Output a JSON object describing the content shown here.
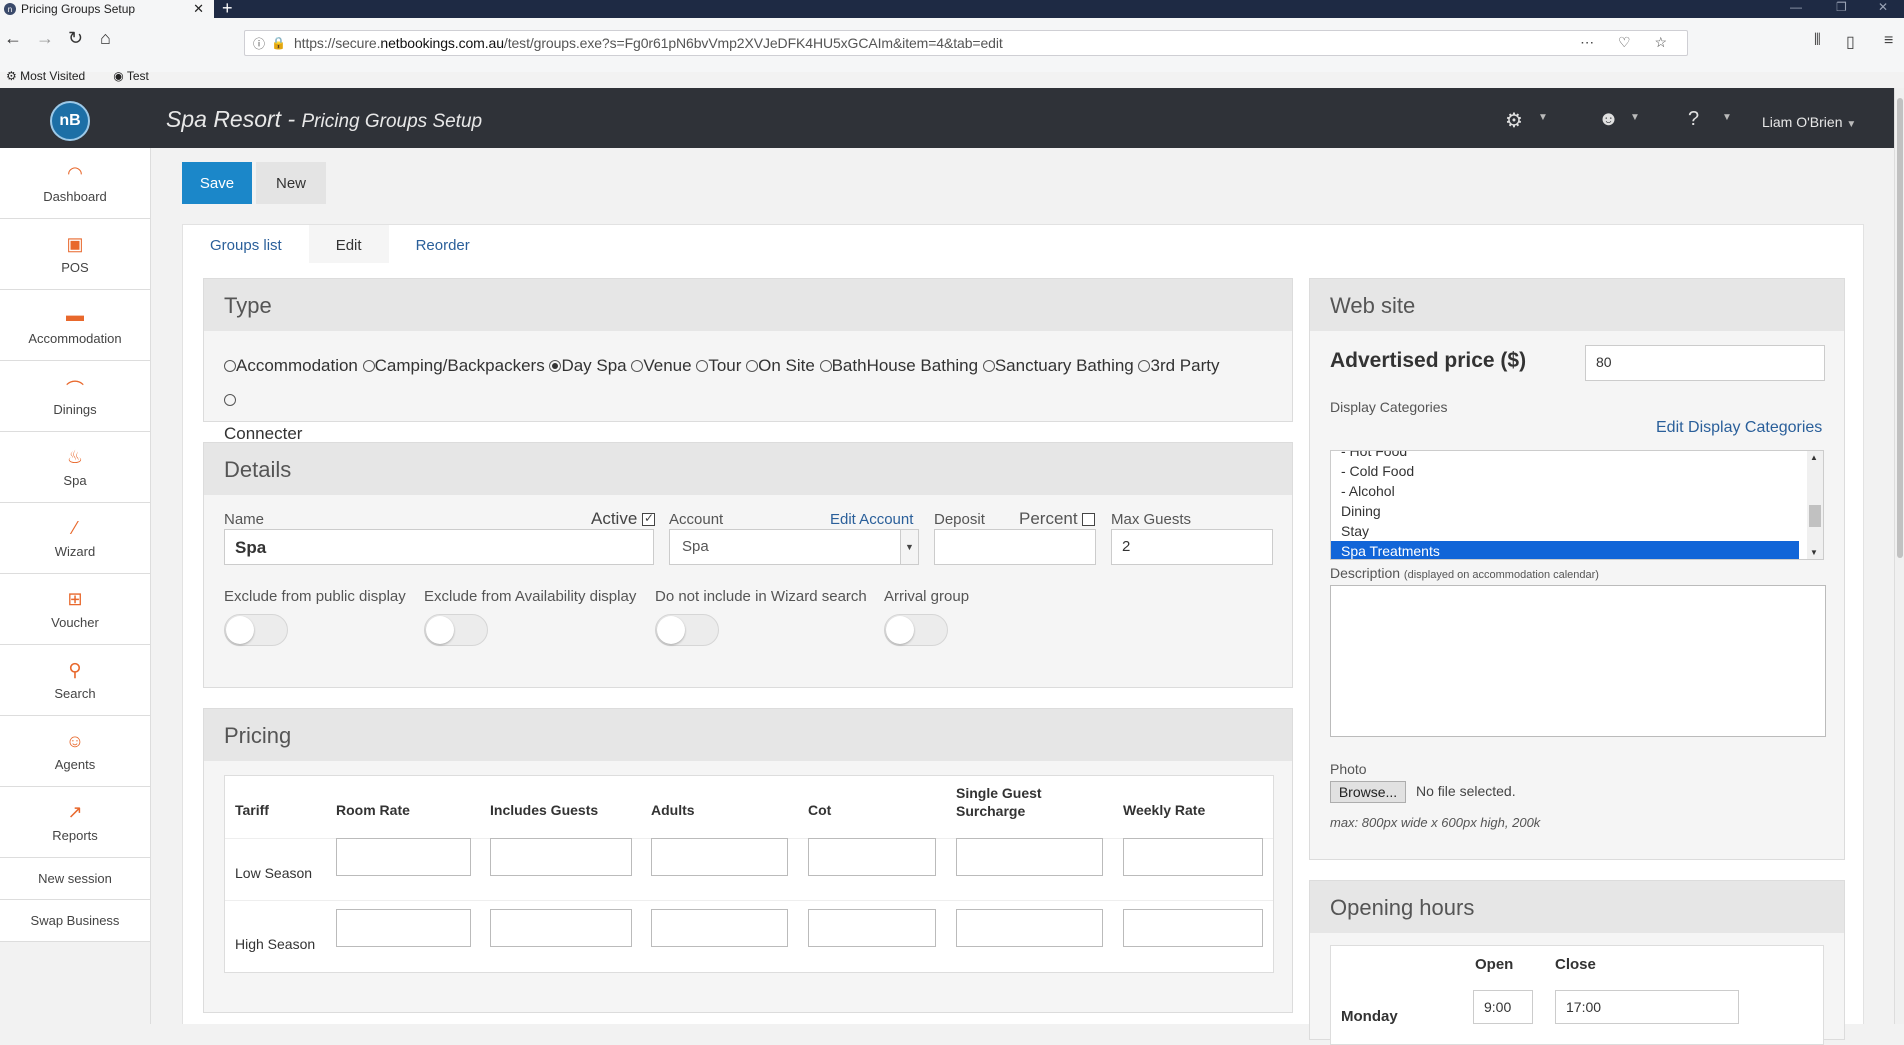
{
  "browser": {
    "tab_title": "Pricing Groups Setup",
    "url_prefix": "https://secure.",
    "url_domain": "netbookings.com.au",
    "url_rest": "/test/groups.exe?s=Fg0r61pN6bvVmp2XVJeDFK4HU5xGCAIm&item=4&tab=edit",
    "bookmarks": [
      "Most Visited",
      "Test"
    ]
  },
  "header": {
    "logo": "nB",
    "business": "Spa Resort - ",
    "page": "Pricing Groups Setup",
    "user": "Liam O'Brien"
  },
  "sidebar": {
    "items": [
      {
        "label": "Dashboard",
        "icon": "dashboard-icon"
      },
      {
        "label": "POS",
        "icon": "pos-icon"
      },
      {
        "label": "Accommodation",
        "icon": "bed-icon"
      },
      {
        "label": "Dinings",
        "icon": "dining-icon"
      },
      {
        "label": "Spa",
        "icon": "spa-icon"
      },
      {
        "label": "Wizard",
        "icon": "wand-icon"
      },
      {
        "label": "Voucher",
        "icon": "gift-icon"
      },
      {
        "label": "Search",
        "icon": "search-icon"
      },
      {
        "label": "Agents",
        "icon": "agent-icon"
      },
      {
        "label": "Reports",
        "icon": "reports-icon"
      }
    ],
    "new_session": "New session",
    "swap_business": "Swap Business"
  },
  "toolbar": {
    "save": "Save",
    "new": "New"
  },
  "tabs": [
    "Groups list",
    "Edit",
    "Reorder"
  ],
  "type_panel": {
    "title": "Type",
    "options": [
      "Accommodation",
      "Camping/Backpackers",
      "Day Spa",
      "Venue",
      "Tour",
      "On Site",
      "BathHouse Bathing",
      "Sanctuary Bathing",
      "3rd Party",
      "Connecter"
    ],
    "selected": "Day Spa"
  },
  "details": {
    "title": "Details",
    "name_label": "Name",
    "name_value": "Spa",
    "active_label": "Active",
    "account_label": "Account",
    "edit_account": "Edit Account",
    "account_value": "Spa",
    "deposit_label": "Deposit",
    "deposit_value": "",
    "percent_label": "Percent",
    "max_guests_label": "Max Guests",
    "max_guests_value": "2",
    "toggles": [
      "Exclude from public display",
      "Exclude from Availability display",
      "Do not include in Wizard search",
      "Arrival group"
    ]
  },
  "pricing": {
    "title": "Pricing",
    "headers": [
      "Tariff",
      "Room Rate",
      "Includes Guests",
      "Adults",
      "Cot",
      "Single Guest Surcharge",
      "Weekly Rate"
    ],
    "rows": [
      "Low Season",
      "High Season"
    ]
  },
  "website": {
    "title": "Web site",
    "advertised_label": "Advertised price ($)",
    "advertised_value": "80",
    "display_categories_label": "Display Categories",
    "edit_display_categories": "Edit Display Categories",
    "categories": [
      "- Hot Food",
      "- Cold Food",
      "- Alcohol",
      "Dining",
      "Stay",
      "Spa Treatments"
    ],
    "selected_category": "Spa Treatments",
    "description_label": "Description",
    "description_note": "(displayed on accommodation calendar)",
    "photo_label": "Photo",
    "browse": "Browse...",
    "no_file": "No file selected.",
    "max_note": "max: 800px wide x 600px high, 200k"
  },
  "opening_hours": {
    "title": "Opening hours",
    "open_label": "Open",
    "close_label": "Close",
    "day": "Monday",
    "open_value": "9:00",
    "close_value": "17:00"
  }
}
